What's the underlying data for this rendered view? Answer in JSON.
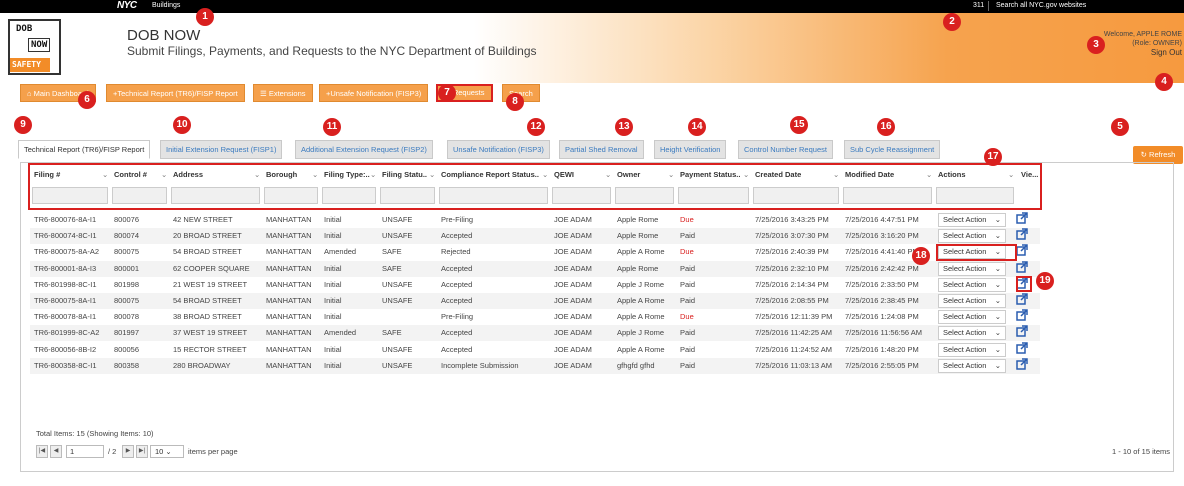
{
  "topbar": {
    "nyc": "NYC",
    "buildings": "Buildings",
    "t311": "311",
    "search_all": "Search all NYC.gov websites"
  },
  "logo": {
    "line1": "DOB",
    "line2": "NOW",
    "line3": "SAFETY"
  },
  "header": {
    "title": "DOB NOW",
    "subtitle": "Submit Filings, Payments, and Requests to the NYC Department of Buildings",
    "welcome": "Welcome, APPLE ROME",
    "role": "(Role: OWNER)",
    "sign_out": "Sign Out"
  },
  "actions": {
    "main_dashboard": "Main Dashboard",
    "technical_report": "Technical Report (TR6)/FISP Report",
    "extensions": "Extensions",
    "unsafe_notification": "Unsafe Notification (FISP3)",
    "requests": "Requests",
    "search": "Search"
  },
  "tabs": [
    "Technical Report (TR6)/FISP Report",
    "Initial Extension Request (FISP1)",
    "Additional Extension Request (FISP2)",
    "Unsafe Notification (FISP3)",
    "Partial Shed Removal",
    "Height Verification",
    "Control Number Request",
    "Sub Cycle Reassignment"
  ],
  "refresh": "Refresh",
  "columns": [
    "Filing #",
    "Control #",
    "Address",
    "Borough",
    "Filing Type:..",
    "Filing Statu..",
    "Compliance Report Status..",
    "QEWI",
    "Owner",
    "Payment Status..",
    "Created Date",
    "Modified Date",
    "Actions",
    "Vie..."
  ],
  "rows": [
    [
      "TR6-800076-8A-I1",
      "800076",
      "42 NEW STREET",
      "MANHATTAN",
      "Initial",
      "UNSAFE",
      "Pre-Filing",
      "JOE ADAM",
      "Apple Rome",
      "Due",
      "7/25/2016 3:43:25 PM",
      "7/25/2016 4:47:51 PM"
    ],
    [
      "TR6-800074-8C-I1",
      "800074",
      "20 BROAD STREET",
      "MANHATTAN",
      "Initial",
      "UNSAFE",
      "Accepted",
      "JOE ADAM",
      "Apple Rome",
      "Paid",
      "7/25/2016 3:07:30 PM",
      "7/25/2016 3:16:20 PM"
    ],
    [
      "TR6-800075-8A-A2",
      "800075",
      "54 BROAD STREET",
      "MANHATTAN",
      "Amended",
      "SAFE",
      "Rejected",
      "JOE ADAM",
      "Apple A Rome",
      "Due",
      "7/25/2016 2:40:39 PM",
      "7/25/2016 4:41:40 PM"
    ],
    [
      "TR6-800001-8A-I3",
      "800001",
      "62 COOPER SQUARE",
      "MANHATTAN",
      "Initial",
      "SAFE",
      "Accepted",
      "JOE ADAM",
      "Apple Rome",
      "Paid",
      "7/25/2016 2:32:10 PM",
      "7/25/2016 2:42:42 PM"
    ],
    [
      "TR6-801998-8C-I1",
      "801998",
      "21 WEST 19 STREET",
      "MANHATTAN",
      "Initial",
      "UNSAFE",
      "Accepted",
      "JOE ADAM",
      "Apple J Rome",
      "Paid",
      "7/25/2016 2:14:34 PM",
      "7/25/2016 2:33:50 PM"
    ],
    [
      "TR6-800075-8A-I1",
      "800075",
      "54 BROAD STREET",
      "MANHATTAN",
      "Initial",
      "UNSAFE",
      "Accepted",
      "JOE ADAM",
      "Apple A Rome",
      "Paid",
      "7/25/2016 2:08:55 PM",
      "7/25/2016 2:38:45 PM"
    ],
    [
      "TR6-800078-8A-I1",
      "800078",
      "38 BROAD STREET",
      "MANHATTAN",
      "Initial",
      "",
      "Pre-Filing",
      "JOE ADAM",
      "Apple A Rome",
      "Due",
      "7/25/2016 12:11:39 PM",
      "7/25/2016 1:24:08 PM"
    ],
    [
      "TR6-801999-8C-A2",
      "801997",
      "37 WEST 19 STREET",
      "MANHATTAN",
      "Amended",
      "SAFE",
      "Accepted",
      "JOE ADAM",
      "Apple J Rome",
      "Paid",
      "7/25/2016 11:42:25 AM",
      "7/25/2016 11:56:56 AM"
    ],
    [
      "TR6-800056-8B-I2",
      "800056",
      "15 RECTOR STREET",
      "MANHATTAN",
      "Initial",
      "UNSAFE",
      "Accepted",
      "JOE ADAM",
      "Apple A Rome",
      "Paid",
      "7/25/2016 11:24:52 AM",
      "7/25/2016 1:48:20 PM"
    ],
    [
      "TR6-800358-8C-I1",
      "800358",
      "280 BROADWAY",
      "MANHATTAN",
      "Initial",
      "UNSAFE",
      "Incomplete Submission",
      "JOE ADAM",
      "gfhgfd gfhd",
      "Paid",
      "7/25/2016 11:03:13 AM",
      "7/25/2016 2:55:05 PM"
    ]
  ],
  "select_action": "Select Action",
  "totals": "Total Items: 15 (Showing Items: 10)",
  "pager": {
    "page": "1",
    "of_pages": "/ 2",
    "page_size": "10",
    "per_page_label": "items per page",
    "range": "1 - 10 of 15 items"
  },
  "badges": [
    "1",
    "2",
    "3",
    "4",
    "5",
    "6",
    "7",
    "8",
    "9",
    "10",
    "11",
    "12",
    "13",
    "14",
    "15",
    "16",
    "17",
    "18",
    "19"
  ],
  "colors": {
    "accent": "#f28c28",
    "annotation": "#d9201f",
    "link": "#3b7bbf"
  }
}
